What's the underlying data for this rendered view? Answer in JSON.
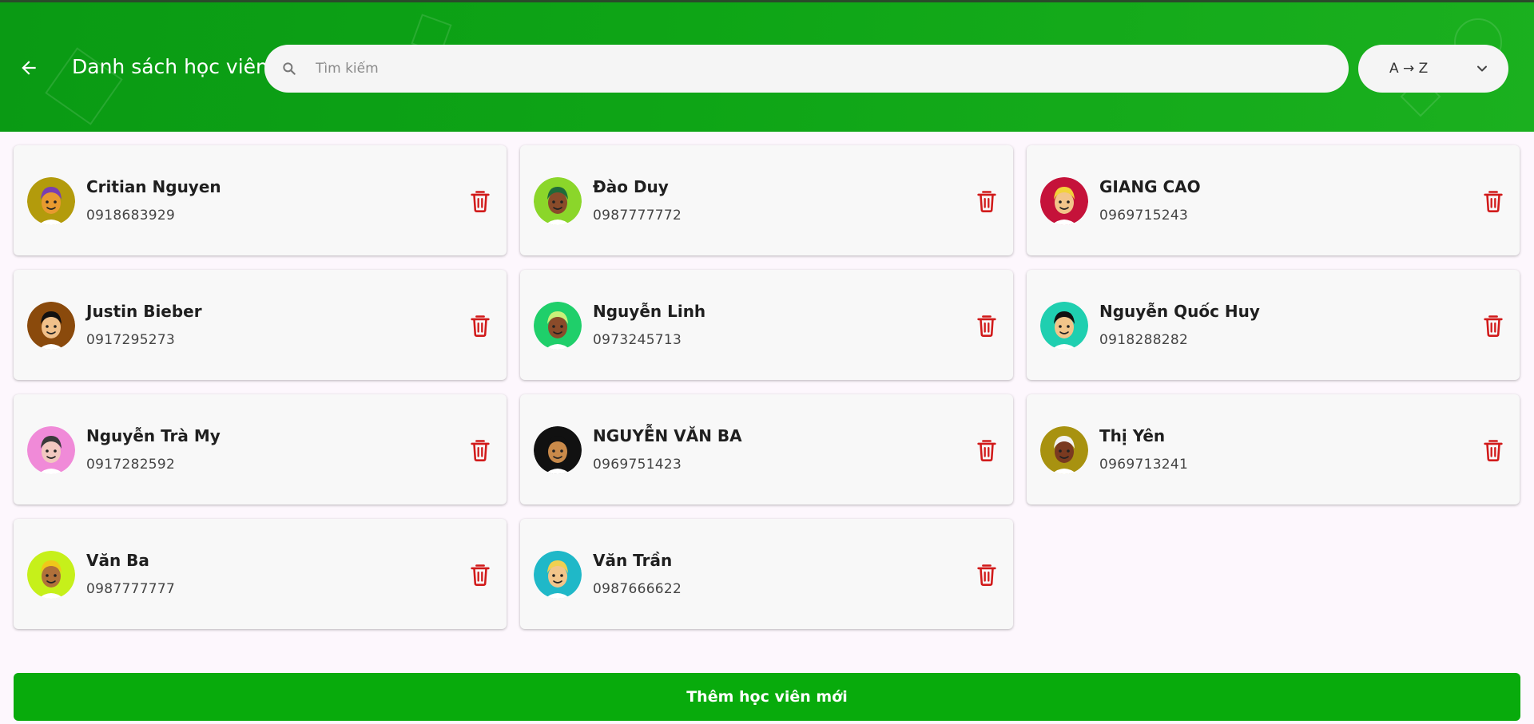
{
  "header": {
    "title": "Danh sách học viên",
    "back_icon": "arrow-left-icon",
    "search": {
      "placeholder": "Tìm kiếm",
      "value": "",
      "icon": "search-icon"
    },
    "sort": {
      "selected": "A → Z",
      "icon": "chevron-down-icon"
    }
  },
  "colors": {
    "header_green": "#0ea516",
    "button_green": "#08ab0c",
    "delete_red": "#d11a1a",
    "page_bg": "#fdf7fd"
  },
  "students": [
    {
      "name": "Critian Nguyen",
      "phone": "0918683929",
      "avatar_bg": "#b39b0c",
      "skin": "#e89a2f",
      "hair": "#7a3fb0"
    },
    {
      "name": "Đào Duy",
      "phone": "0987777772",
      "avatar_bg": "#8bd62a",
      "skin": "#8a4b2a",
      "hair": "#1f6a3a"
    },
    {
      "name": "GIANG CAO",
      "phone": "0969715243",
      "avatar_bg": "#c5123a",
      "skin": "#f2c58a",
      "hair": "#f2d23a"
    },
    {
      "name": "Justin Bieber",
      "phone": "0917295273",
      "avatar_bg": "#8a4a0c",
      "skin": "#f0c08a",
      "hair": "#111111"
    },
    {
      "name": "Nguyễn Linh",
      "phone": "0973245713",
      "avatar_bg": "#1fcf6a",
      "skin": "#8a4b2a",
      "hair": "#c9f07a"
    },
    {
      "name": "Nguyễn Quốc Huy",
      "phone": "0918288282",
      "avatar_bg": "#1fcfb0",
      "skin": "#f2c58a",
      "hair": "#111111"
    },
    {
      "name": "Nguyễn Trà My",
      "phone": "0917282592",
      "avatar_bg": "#f08ad8",
      "skin": "#f2c8c0",
      "hair": "#3a3a3a"
    },
    {
      "name": "NGUYỄN VĂN BA",
      "phone": "0969751423",
      "avatar_bg": "#111111",
      "skin": "#c98a4a",
      "hair": "#111111"
    },
    {
      "name": "Thị Yên",
      "phone": "0969713241",
      "avatar_bg": "#a89210",
      "skin": "#7a3a20",
      "hair": "#f2f2f2"
    },
    {
      "name": "Văn Ba",
      "phone": "0987777777",
      "avatar_bg": "#c6f01a",
      "skin": "#b0703a",
      "hair": "#f0c81a"
    },
    {
      "name": "Văn Trần",
      "phone": "0987666622",
      "avatar_bg": "#1fb8c8",
      "skin": "#f2c58a",
      "hair": "#f0d050"
    }
  ],
  "card_actions": {
    "delete_icon": "trash-icon"
  },
  "footer": {
    "add_button_label": "Thêm học viên mới"
  }
}
